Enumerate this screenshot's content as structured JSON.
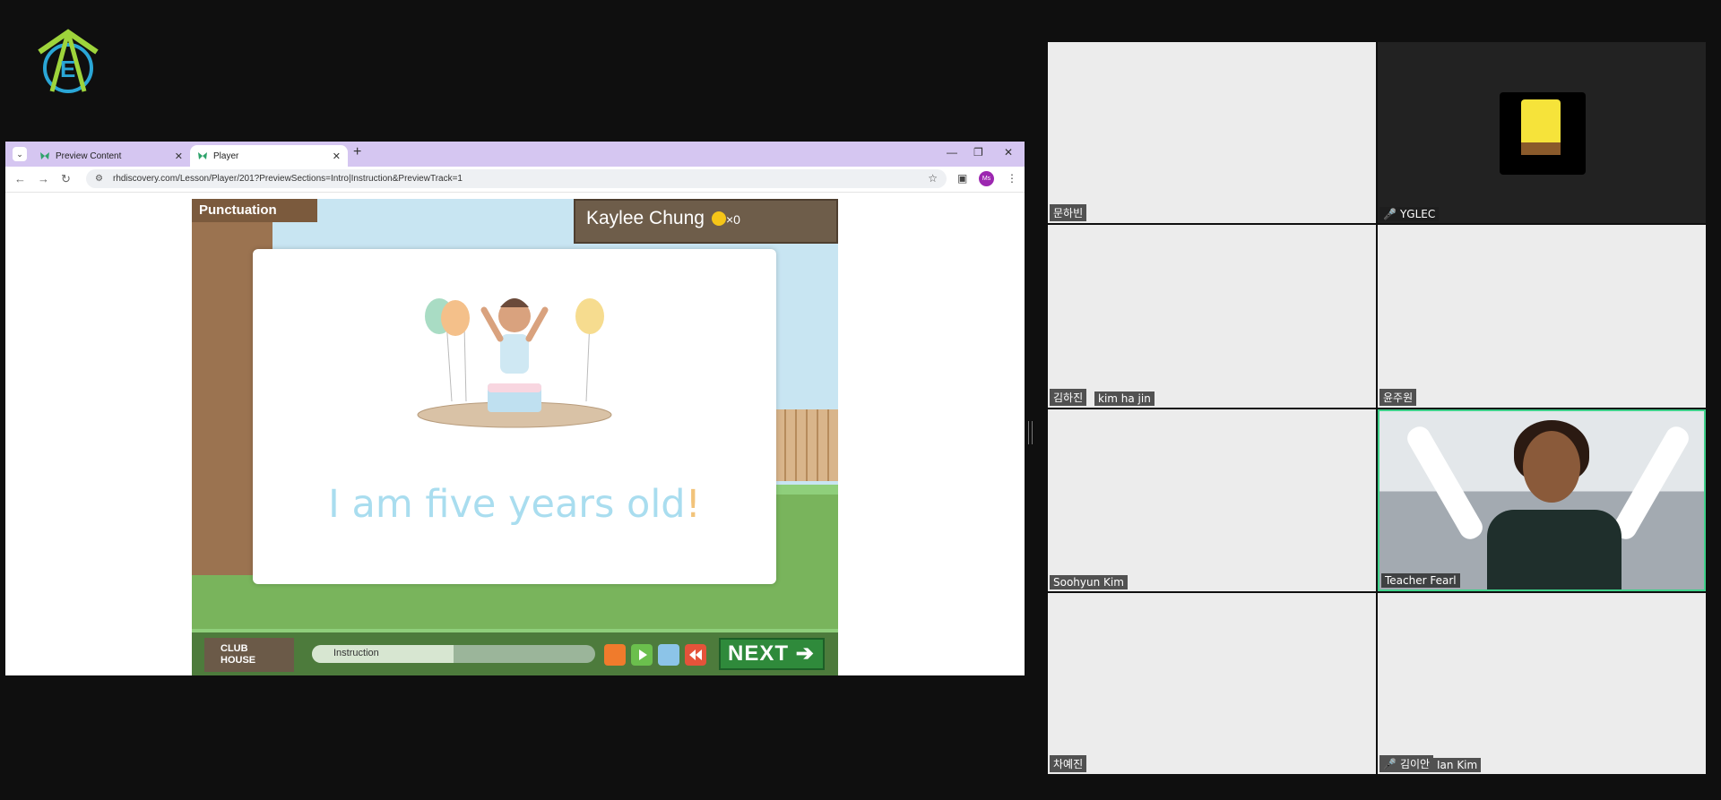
{
  "browser": {
    "tabs": [
      {
        "label": "Preview Content",
        "active": false
      },
      {
        "label": "Player",
        "active": true
      }
    ],
    "url": "rhdiscovery.com/Lesson/Player/201?PreviewSections=Intro|Instruction&PreviewTrack=1",
    "profile_initials": "Ms"
  },
  "game": {
    "section_title": "Punctuation",
    "student_name": "Kaylee Chung",
    "coin_count": "×0",
    "sentence_main": "I am five years old",
    "sentence_punct": "!",
    "clubhouse_line1": "CLUB",
    "clubhouse_line2": "HOUSE",
    "progress_label": "Instruction",
    "next_label": "NEXT"
  },
  "participants": {
    "tile1": {
      "name": "문하빈"
    },
    "tile2": {
      "name": "YGLEC",
      "muted": true
    },
    "tile3": {
      "name": "김하진",
      "name2": "kim ha jin"
    },
    "tile4": {
      "name": "윤주원"
    },
    "tile5": {
      "name": "Soohyun Kim"
    },
    "tile6": {
      "name": "Teacher Fearl",
      "active_speaker": true
    },
    "tile7": {
      "name": "차예진"
    },
    "tile8": {
      "name": "김이안",
      "name2": "Ian Kim",
      "muted": true
    }
  },
  "colors": {
    "tabbar": "#d5c6f1",
    "sentence_text": "#a9ddef",
    "punctuation": "#f2c37a",
    "active_speaker_border": "#3fd08a",
    "next_button": "#2f8a3b"
  },
  "icons": [
    "logo-icon",
    "back-icon",
    "forward-icon",
    "reload-icon",
    "star-icon",
    "close-icon",
    "plus-icon",
    "mic-muted-icon",
    "play-icon",
    "replay-icon"
  ]
}
